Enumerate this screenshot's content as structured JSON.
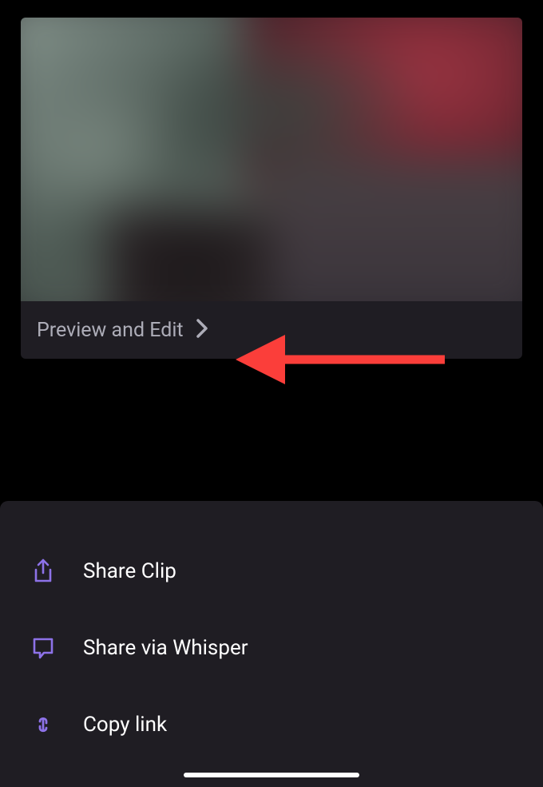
{
  "videoCard": {
    "previewLabel": "Preview and Edit"
  },
  "sheet": {
    "items": [
      {
        "icon": "share-icon",
        "label": "Share Clip"
      },
      {
        "icon": "whisper-icon",
        "label": "Share via Whisper"
      },
      {
        "icon": "link-icon",
        "label": "Copy link"
      }
    ]
  },
  "colors": {
    "accent": "#8d72e8",
    "annotation": "#fb3e3a"
  }
}
